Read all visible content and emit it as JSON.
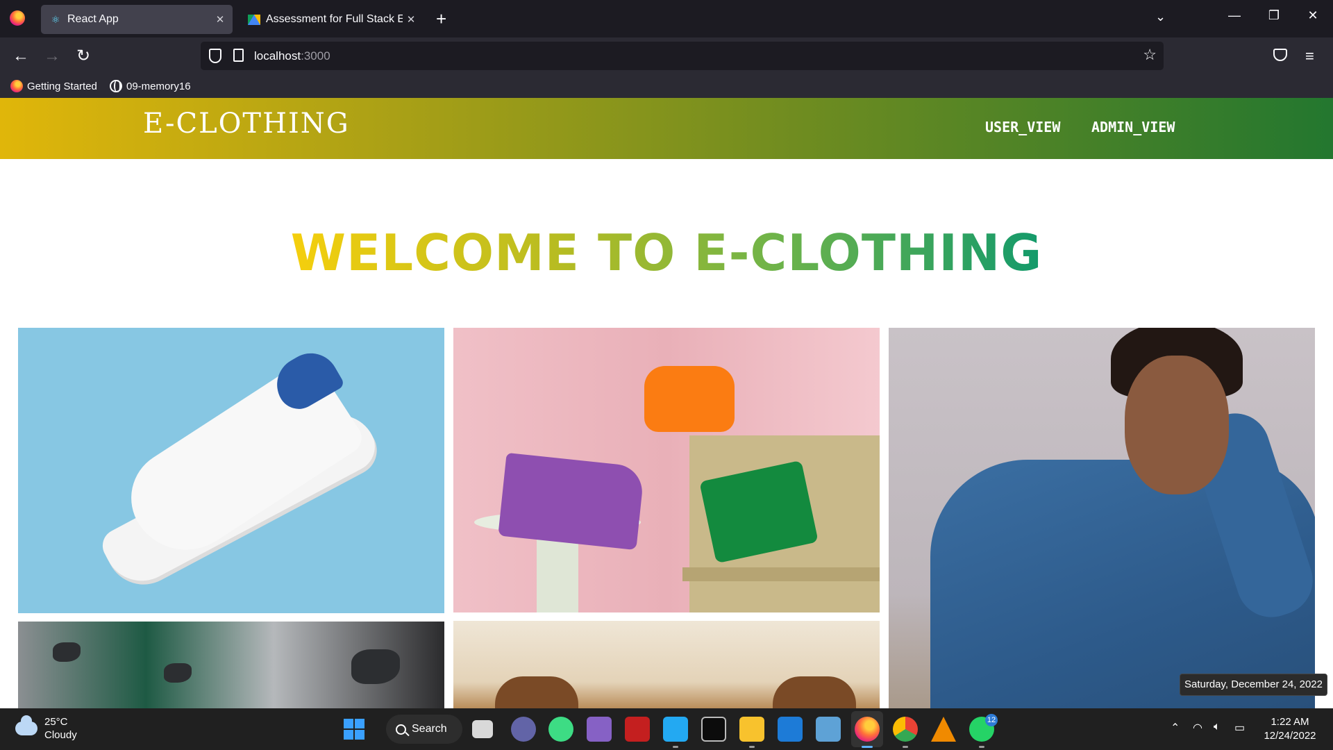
{
  "browser": {
    "tabs": [
      {
        "label": "React App",
        "icon": "react-icon"
      },
      {
        "label": "Assessment for Full Stack Engin",
        "icon": "google-drive-icon"
      }
    ],
    "url": {
      "host": "localhost",
      "port": ":3000"
    },
    "bookmarks": [
      {
        "label": "Getting Started",
        "icon": "firefox-icon"
      },
      {
        "label": "09-memory16",
        "icon": "globe-icon"
      }
    ]
  },
  "site": {
    "brand": "E-CLOTHING",
    "nav": {
      "user_view": "USER_VIEW",
      "admin_view": "ADMIN_VIEW"
    },
    "hero_title": "WELCOME TO E-CLOTHING",
    "gallery": [
      {
        "subject": "white sneaker on blue background"
      },
      {
        "subject": "purple, orange and green handbags"
      },
      {
        "subject": "model in denim jumpsuit"
      },
      {
        "subject": "dark rocks on green and gravel"
      },
      {
        "subject": "brown leather bags on cream fabric"
      }
    ],
    "colors": {
      "header_start": "#e0b60a",
      "header_end": "#23772f",
      "title_start": "#f5cf0d",
      "title_end": "#139a6b"
    }
  },
  "tooltip": {
    "text": "Saturday, December 24, 2022"
  },
  "taskbar": {
    "weather": {
      "temp": "25°C",
      "condition": "Cloudy"
    },
    "search_label": "Search",
    "whatsapp_badge": "12",
    "clock": {
      "time": "1:22 AM",
      "date": "12/24/2022"
    }
  }
}
